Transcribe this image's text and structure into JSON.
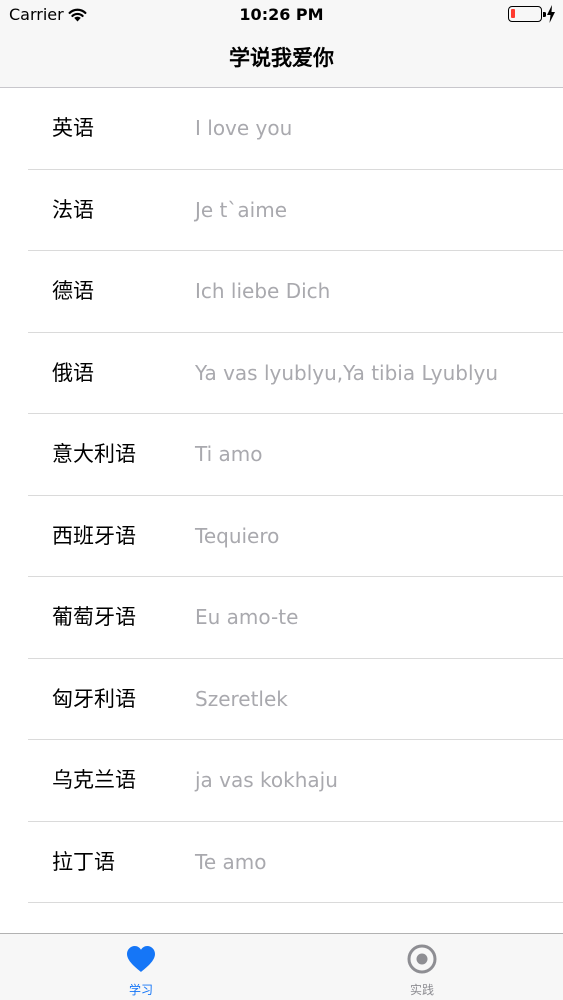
{
  "status_bar": {
    "carrier": "Carrier",
    "time": "10:26 PM",
    "battery_color": "#ff3b30"
  },
  "nav": {
    "title": "学说我爱你"
  },
  "rows": [
    {
      "language": "英语",
      "phrase": "I love you"
    },
    {
      "language": "法语",
      "phrase": "Je t`aime"
    },
    {
      "language": "德语",
      "phrase": "Ich liebe Dich"
    },
    {
      "language": "俄语",
      "phrase": "Ya vas lyublyu,Ya tibia Lyublyu"
    },
    {
      "language": "意大利语",
      "phrase": "Ti amo"
    },
    {
      "language": "西班牙语",
      "phrase": "Tequiero"
    },
    {
      "language": "葡萄牙语",
      "phrase": "Eu amo-te"
    },
    {
      "language": "匈牙利语",
      "phrase": "Szeretlek"
    },
    {
      "language": "乌克兰语",
      "phrase": "ja vas kokhaju"
    },
    {
      "language": "拉丁语",
      "phrase": "Te amo"
    },
    {
      "language": "",
      "phrase": ""
    }
  ],
  "tab_bar": {
    "tabs": [
      {
        "label": "学习",
        "icon": "heart-icon",
        "selected": true,
        "color": "#1576f7"
      },
      {
        "label": "实践",
        "icon": "target-icon",
        "selected": false,
        "color": "#8e8e93"
      }
    ]
  }
}
